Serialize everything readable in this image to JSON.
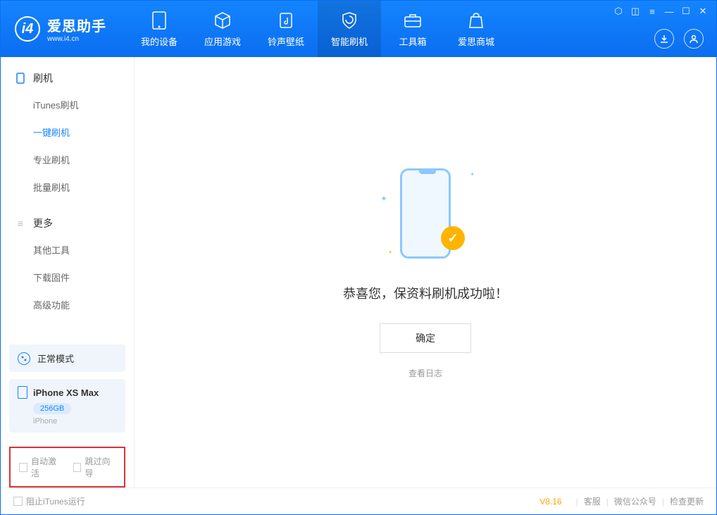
{
  "logo": {
    "title": "爱思助手",
    "sub": "www.i4.cn"
  },
  "nav": [
    {
      "label": "我的设备",
      "icon": "device"
    },
    {
      "label": "应用游戏",
      "icon": "cube"
    },
    {
      "label": "铃声壁纸",
      "icon": "note"
    },
    {
      "label": "智能刷机",
      "icon": "shield",
      "active": true
    },
    {
      "label": "工具箱",
      "icon": "toolbox"
    },
    {
      "label": "爱思商城",
      "icon": "bag"
    }
  ],
  "sidebar": {
    "section1": {
      "title": "刷机",
      "items": [
        "iTunes刷机",
        "一键刷机",
        "专业刷机",
        "批量刷机"
      ],
      "activeIndex": 1
    },
    "section2": {
      "title": "更多",
      "items": [
        "其他工具",
        "下载固件",
        "高级功能"
      ]
    },
    "mode": "正常模式",
    "device": {
      "name": "iPhone XS Max",
      "capacity": "256GB",
      "type": "iPhone"
    },
    "options": {
      "auto_activate": "自动激活",
      "skip_guide": "跳过向导"
    }
  },
  "main": {
    "success_title": "恭喜您，保资料刷机成功啦！",
    "confirm": "确定",
    "view_log": "查看日志"
  },
  "footer": {
    "block_itunes": "阻止iTunes运行",
    "version": "V8.16",
    "links": [
      "客服",
      "微信公众号",
      "检查更新"
    ]
  }
}
